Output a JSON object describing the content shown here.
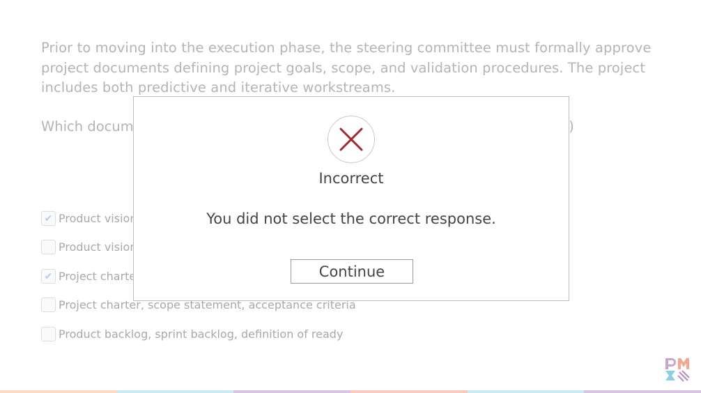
{
  "question": {
    "scenario": "Prior to moving into the execution phase, the steering committee must formally approve project documents defining project goals, scope, and validation procedures. The project includes both predictive and iterative workstreams.",
    "prompt_visible_start": "Which docum",
    "prompt_visible_end": ".)"
  },
  "options": [
    {
      "label": "Product vision",
      "checked": true
    },
    {
      "label": "Product vision",
      "checked": false
    },
    {
      "label": "Project charte",
      "checked": true
    },
    {
      "label": "Project charter, scope statement, acceptance criteria",
      "checked": false
    },
    {
      "label": "Product backlog,  sprint backlog,  definition of ready",
      "checked": false
    }
  ],
  "feedback": {
    "icon": "x-mark-icon",
    "icon_color": "#a12a2a",
    "title": "Incorrect",
    "message": "You did not select the correct response.",
    "button_label": "Continue"
  },
  "footer_colors": [
    "#fbd9c7",
    "#cde9f2",
    "#d7c5e2",
    "#f9cbc0",
    "#cde9f2",
    "#d7c5e2"
  ],
  "brand": {
    "logo": "pmi-logo"
  }
}
